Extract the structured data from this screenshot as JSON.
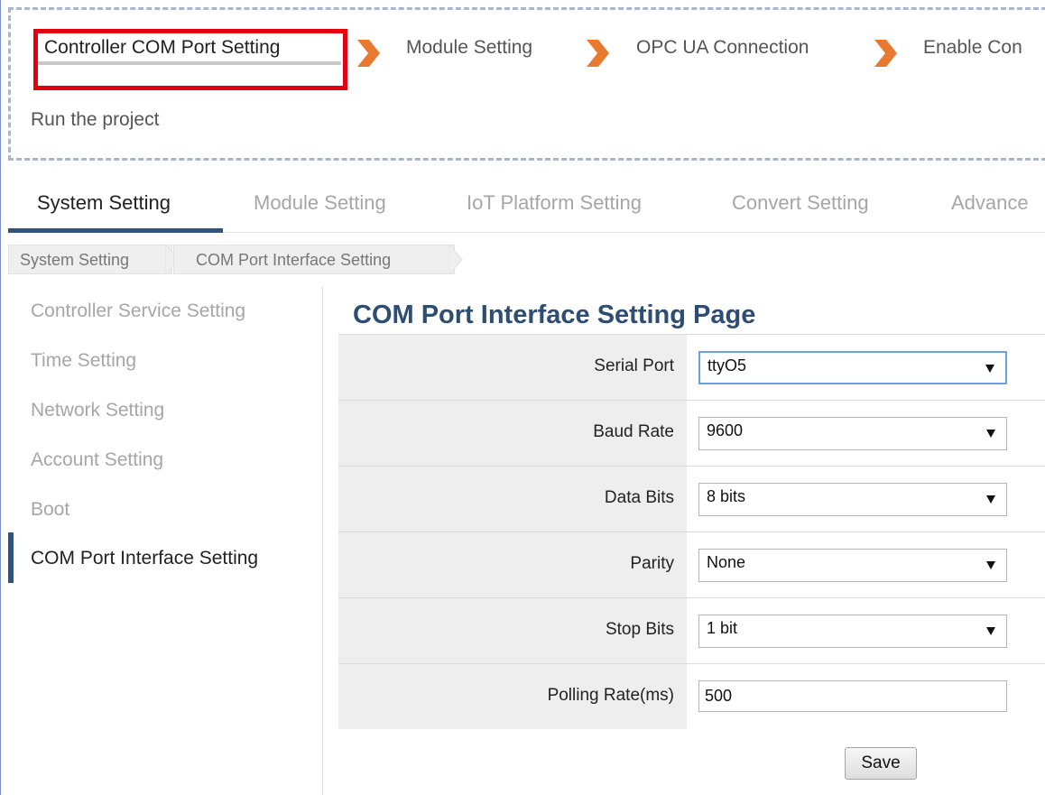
{
  "wizard": {
    "steps": [
      {
        "label": "Controller COM Port Setting"
      },
      {
        "label": "Module Setting"
      },
      {
        "label": "OPC UA Connection"
      },
      {
        "label": "Enable Con"
      },
      {
        "label": "Run the project"
      }
    ],
    "highlight_color": "#e4000f",
    "chevron_color": "#e8792e"
  },
  "tabs": {
    "items": [
      {
        "label": "System Setting"
      },
      {
        "label": "Module Setting"
      },
      {
        "label": "IoT Platform Setting"
      },
      {
        "label": "Convert Setting"
      },
      {
        "label": "Advance"
      }
    ],
    "active_index": 0,
    "accent_color": "#33547a"
  },
  "breadcrumb": {
    "items": [
      "System Setting",
      "COM Port Interface Setting"
    ]
  },
  "sidebar": {
    "items": [
      {
        "label": "Controller Service Setting"
      },
      {
        "label": "Time Setting"
      },
      {
        "label": "Network Setting"
      },
      {
        "label": "Account Setting"
      },
      {
        "label": "Boot"
      },
      {
        "label": "COM Port Interface Setting"
      }
    ],
    "active_index": 5
  },
  "main": {
    "title": "COM Port Interface Setting Page",
    "title_color": "#2d4d73",
    "fields": {
      "serial_port": {
        "label": "Serial Port",
        "value": "ttyO5"
      },
      "baud_rate": {
        "label": "Baud Rate",
        "value": "9600"
      },
      "data_bits": {
        "label": "Data Bits",
        "value": "8 bits"
      },
      "parity": {
        "label": "Parity",
        "value": "None"
      },
      "stop_bits": {
        "label": "Stop Bits",
        "value": "1 bit"
      },
      "polling_rate": {
        "label": "Polling Rate(ms)",
        "value": "500"
      }
    },
    "save_label": "Save"
  }
}
